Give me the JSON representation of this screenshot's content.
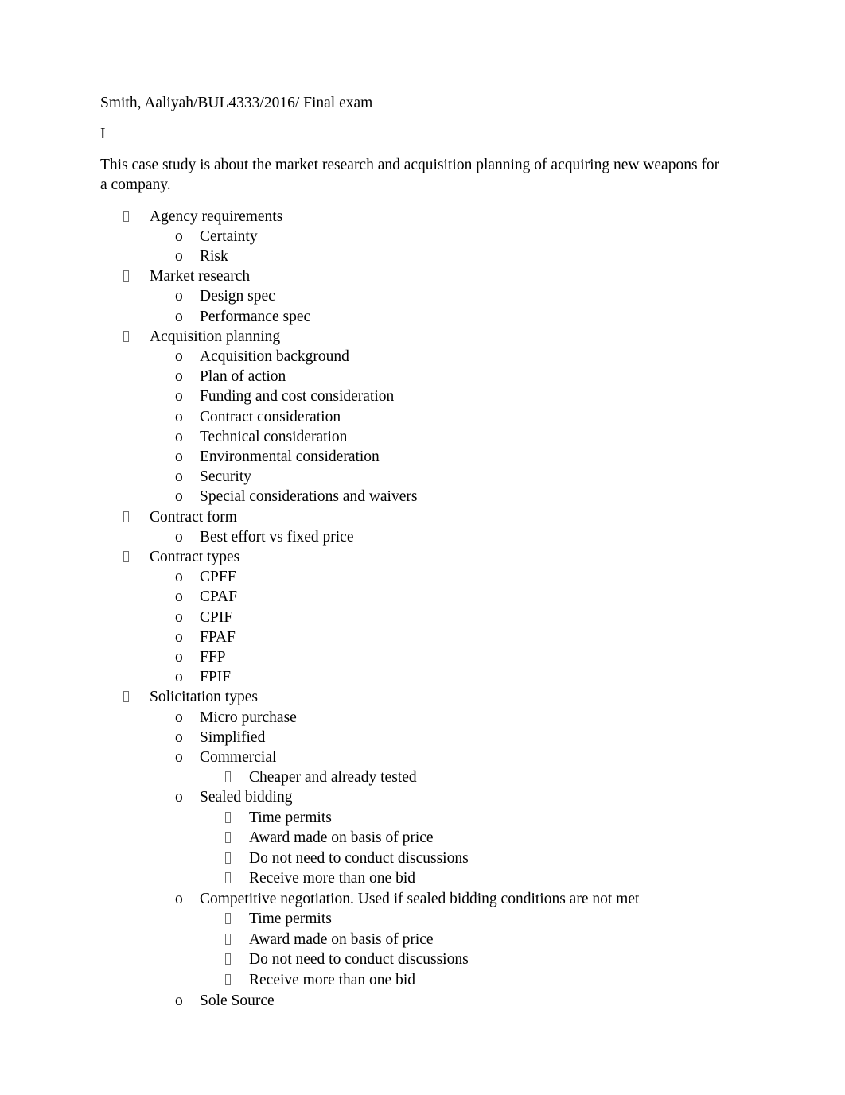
{
  "document": {
    "header_line": "Smith, Aaliyah/BUL4333/2016/ Final exam",
    "section_marker": "I",
    "intro_paragraph": "This case study is about the market research and acquisition planning of acquiring new weapons for a company.",
    "markers": {
      "level1": "\u0000",
      "level2": "o",
      "level3": "\u0000"
    },
    "outline": [
      {
        "level": 1,
        "text": "Agency requirements"
      },
      {
        "level": 2,
        "text": "Certainty"
      },
      {
        "level": 2,
        "text": "Risk"
      },
      {
        "level": 1,
        "text": "Market research"
      },
      {
        "level": 2,
        "text": "Design spec"
      },
      {
        "level": 2,
        "text": "Performance spec"
      },
      {
        "level": 1,
        "text": "Acquisition planning"
      },
      {
        "level": 2,
        "text": "Acquisition background"
      },
      {
        "level": 2,
        "text": "Plan of action"
      },
      {
        "level": 2,
        "text": "Funding and cost consideration"
      },
      {
        "level": 2,
        "text": "Contract consideration"
      },
      {
        "level": 2,
        "text": "Technical consideration"
      },
      {
        "level": 2,
        "text": "Environmental consideration"
      },
      {
        "level": 2,
        "text": "Security"
      },
      {
        "level": 2,
        "text": "Special considerations and waivers"
      },
      {
        "level": 1,
        "text": "Contract form"
      },
      {
        "level": 2,
        "text": "Best effort vs fixed price"
      },
      {
        "level": 1,
        "text": "Contract types"
      },
      {
        "level": 2,
        "text": "CPFF"
      },
      {
        "level": 2,
        "text": "CPAF"
      },
      {
        "level": 2,
        "text": "CPIF"
      },
      {
        "level": 2,
        "text": "FPAF"
      },
      {
        "level": 2,
        "text": "FFP"
      },
      {
        "level": 2,
        "text": "FPIF"
      },
      {
        "level": 1,
        "text": "Solicitation types"
      },
      {
        "level": 2,
        "text": "Micro purchase"
      },
      {
        "level": 2,
        "text": "Simplified"
      },
      {
        "level": 2,
        "text": "Commercial"
      },
      {
        "level": 3,
        "text": "Cheaper and already tested"
      },
      {
        "level": 2,
        "text": "Sealed bidding"
      },
      {
        "level": 3,
        "text": "Time permits",
        "spaced": true
      },
      {
        "level": 3,
        "text": "Award made on basis of price",
        "spaced": true
      },
      {
        "level": 3,
        "text": "Do not need to conduct discussions",
        "spaced": true
      },
      {
        "level": 3,
        "text": "Receive more than one bid",
        "spaced": true
      },
      {
        "level": 2,
        "text": "Competitive negotiation. Used if sealed bidding conditions are not met"
      },
      {
        "level": 3,
        "text": "Time permits",
        "spaced": true
      },
      {
        "level": 3,
        "text": "Award made on basis of price",
        "spaced": true
      },
      {
        "level": 3,
        "text": "Do not need to conduct discussions",
        "spaced": true
      },
      {
        "level": 3,
        "text": "Receive more than one bid",
        "spaced": true
      },
      {
        "level": 2,
        "text": "Sole Source"
      }
    ]
  }
}
